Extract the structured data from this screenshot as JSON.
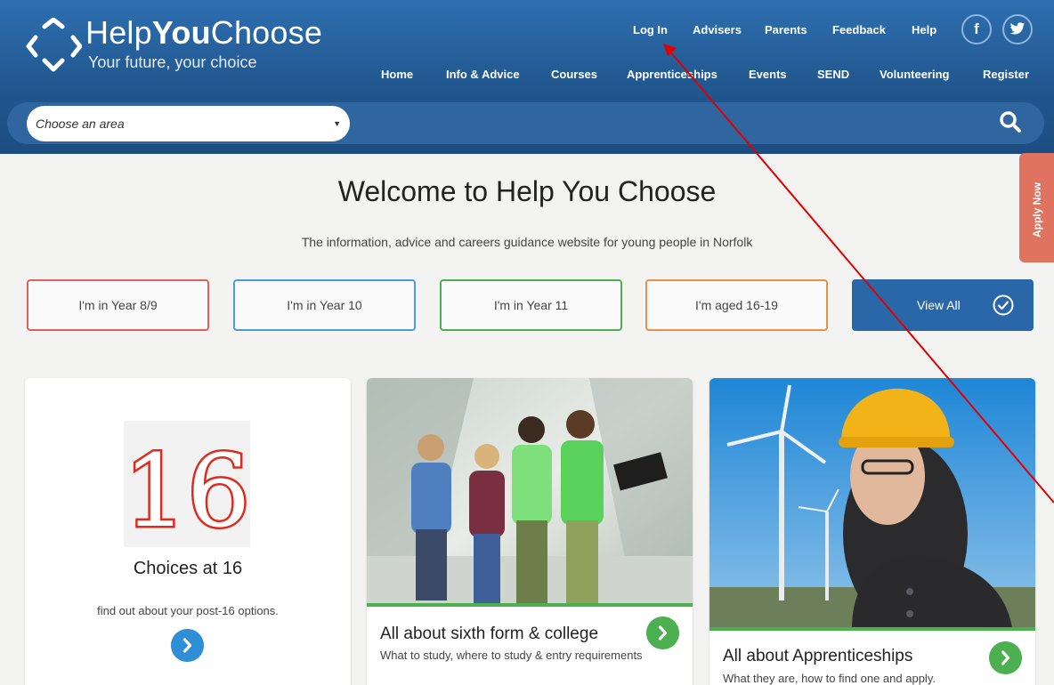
{
  "brand": {
    "name_part1": "Help",
    "name_part2": "You",
    "name_part3": "Choose",
    "tagline": "Your future, your choice"
  },
  "top_links": [
    "Log In",
    "Advisers",
    "Parents",
    "Feedback",
    "Help"
  ],
  "social": {
    "facebook": "f",
    "twitter": "twitter-icon"
  },
  "main_nav": [
    "Home",
    "Info & Advice",
    "Courses",
    "Apprenticeships",
    "Events",
    "SEND",
    "Volunteering",
    "Register"
  ],
  "search": {
    "area_select_value": "Choose an area",
    "icon": "search-icon"
  },
  "apply_tab": "Apply Now",
  "welcome": {
    "title": "Welcome to Help You Choose",
    "subtitle": "The information, advice and careers guidance website for young people in Norfolk"
  },
  "year_buttons": [
    {
      "label": "I'm in Year 8/9",
      "color": "#e0605a"
    },
    {
      "label": "I'm in Year 10",
      "color": "#4a9fd8"
    },
    {
      "label": "I'm in Year 11",
      "color": "#4caf50"
    },
    {
      "label": "I'm aged 16-19",
      "color": "#e7904a"
    }
  ],
  "view_all": {
    "label": "View All",
    "icon": "check-circle-icon",
    "color": "#2a67a8"
  },
  "cards": [
    {
      "image_number": "16",
      "title": "Choices at 16",
      "description": "find out about your post-16 options."
    },
    {
      "title": "All about sixth form & college",
      "description": "What to study, where to study & entry requirements"
    },
    {
      "title": "All about Apprenticeships",
      "description": "What they are, how to find one and apply."
    }
  ],
  "colors": {
    "header": "#21578f",
    "accent_green": "#4caf50",
    "annotation_arrow": "#e00000",
    "apply_tab": "#e0735f"
  }
}
